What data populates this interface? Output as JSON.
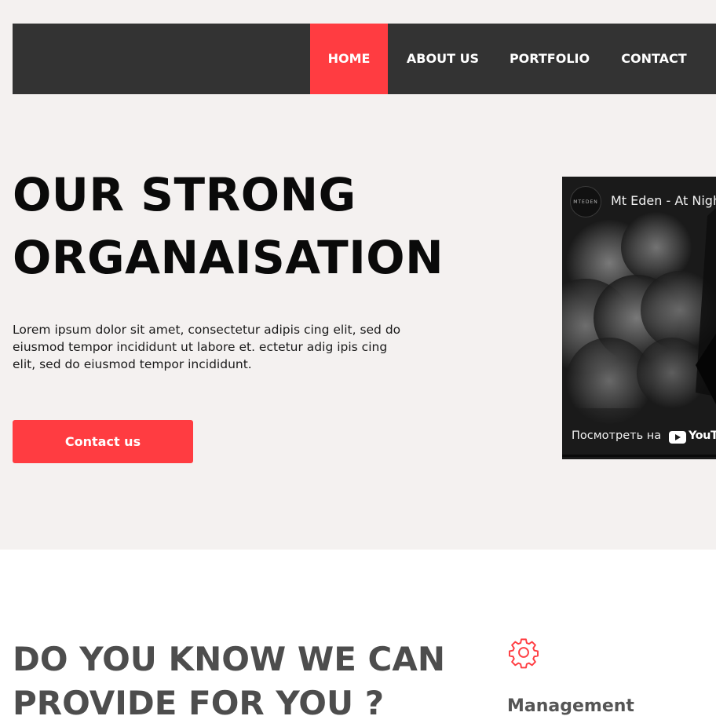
{
  "nav": {
    "items": [
      {
        "label": "HOME",
        "active": true
      },
      {
        "label": "ABOUT US",
        "active": false
      },
      {
        "label": "PORTFOLIO",
        "active": false
      },
      {
        "label": "CONTACT",
        "active": false
      }
    ]
  },
  "hero": {
    "title_line1": "OUR STRONG",
    "title_line2": "ORGANAISATION",
    "text": "Lorem ipsum dolor sit amet, consectetur adipis cing elit, sed do eiusmod tempor incididunt ut labore et. ectetur adig ipis cing elit, sed do eiusmod tempor incididunt.",
    "cta_label": "Contact us"
  },
  "video": {
    "channel_logo_text": "MTEDEN",
    "title": "Mt Eden - At Nigh",
    "watch_on": "Посмотреть на",
    "brand": "YouTub"
  },
  "services": {
    "title_line1": "DO YOU KNOW WE CAN",
    "title_line2": "PROVIDE FOR YOU ?",
    "item_icon": "gear-icon",
    "item_label": "Management"
  },
  "colors": {
    "accent": "#ff3c41",
    "nav_bg": "#333333",
    "page_bg": "#f4f1f0"
  }
}
